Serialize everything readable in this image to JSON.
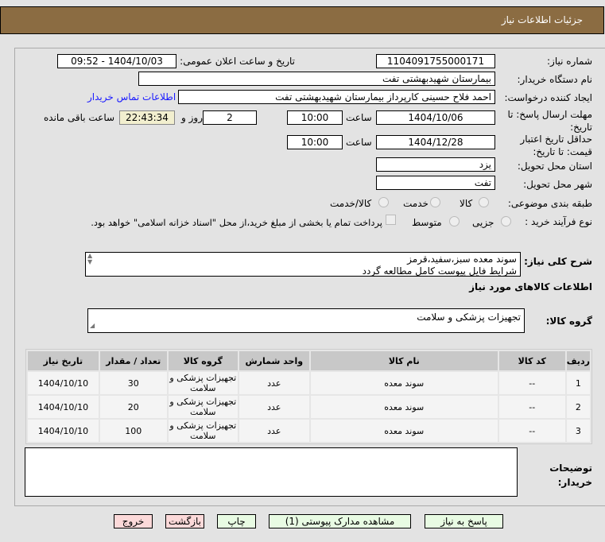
{
  "header": {
    "title": "جزئیات اطلاعات نیاز"
  },
  "form": {
    "need_number_label": "شماره نیاز:",
    "need_number": "1104091755000171",
    "announce_label": "تاریخ و ساعت اعلان عمومی:",
    "announce_value": "1404/10/03 - 09:52",
    "buyer_label": "نام دستگاه خریدار:",
    "buyer": "بیمارستان شهیدبهشتی تفت",
    "creator_label": "ایجاد کننده درخواست:",
    "creator": "احمد فلاح حسینی کارپرداز بیمارستان شهیدبهشتی تفت",
    "contact_link": "اطلاعات تماس خریدار",
    "deadline_label": "مهلت ارسال پاسخ: تا تاریخ:",
    "deadline_date": "1404/10/06",
    "time_label": "ساعت",
    "deadline_time": "10:00",
    "days": "2",
    "days_label": "روز و",
    "remaining": "22:43:34",
    "remaining_label": "ساعت باقی مانده",
    "validity_label": "حداقل تاریخ اعتبار قیمت: تا تاریخ:",
    "validity_date": "1404/12/28",
    "validity_time": "10:00",
    "province_label": "استان محل تحویل:",
    "province": "یزد",
    "city_label": "شهر محل تحویل:",
    "city": "تفت",
    "category_label": "طبقه بندی موضوعی:",
    "category_options": [
      "کالا",
      "خدمت",
      "کالا/خدمت"
    ],
    "category_selected": "کالا",
    "process_label": "نوع فرآیند خرید :",
    "process_options": [
      "جزیی",
      "متوسط"
    ],
    "payment_note": "پرداخت تمام یا بخشی از مبلغ خرید،از محل \"اسناد خزانه اسلامی\" خواهد بود."
  },
  "description": {
    "label": "شرح کلی نیاز:",
    "line1": "سوند معده سبز،سفید،قرمز",
    "line2": "شرایط فایل پیوست کامل مطالعه گردد"
  },
  "goods": {
    "section_title": "اطلاعات کالاهای مورد نیاز",
    "group_label": "گروه کالا:",
    "group_value": "تجهیزات پزشکی و سلامت"
  },
  "table": {
    "headers": [
      "ردیف",
      "کد کالا",
      "نام کالا",
      "واحد شمارش",
      "گروه کالا",
      "تعداد / مقدار",
      "تاریخ نیاز"
    ],
    "rows": [
      [
        "1",
        "--",
        "سوند معده",
        "عدد",
        "تجهیزات پزشکی و سلامت",
        "30",
        "1404/10/10"
      ],
      [
        "2",
        "--",
        "سوند معده",
        "عدد",
        "تجهیزات پزشکی و سلامت",
        "20",
        "1404/10/10"
      ],
      [
        "3",
        "--",
        "سوند معده",
        "عدد",
        "تجهیزات پزشکی و سلامت",
        "100",
        "1404/10/10"
      ]
    ]
  },
  "comments": {
    "label": "توضیحات خریدار:",
    "value": ""
  },
  "buttons": {
    "reply": "پاسخ به نیاز",
    "attachments": "مشاهده مدارک پیوستی (1)",
    "print": "چاپ",
    "back": "بازگشت",
    "exit": "خروج"
  }
}
